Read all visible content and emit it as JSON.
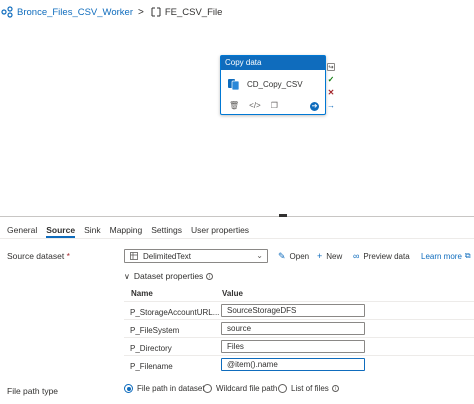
{
  "breadcrumb": {
    "pipeline": "Bronce_Files_CSV_Worker",
    "separator": ">",
    "current": "FE_CSV_File"
  },
  "activity": {
    "type": "Copy data",
    "name": "CD_Copy_CSV"
  },
  "tabs": [
    {
      "label": "General"
    },
    {
      "label": "Source"
    },
    {
      "label": "Sink"
    },
    {
      "label": "Mapping"
    },
    {
      "label": "Settings"
    },
    {
      "label": "User properties"
    }
  ],
  "source": {
    "label": "Source dataset",
    "required": "*",
    "dataset": "DelimitedText",
    "open": "Open",
    "new": "New",
    "preview": "Preview data",
    "learn_more": "Learn more"
  },
  "properties": {
    "heading": "Dataset properties",
    "col_name": "Name",
    "col_value": "Value",
    "rows": [
      {
        "name": "P_StorageAccountURL...",
        "value": "SourceStorageDFS"
      },
      {
        "name": "P_FileSystem",
        "value": "source"
      },
      {
        "name": "P_Directory",
        "value": "Files"
      },
      {
        "name": "P_Filename",
        "value": "@item().name"
      }
    ]
  },
  "file_path_type": {
    "label": "File path type",
    "options": [
      {
        "label": "File path in dataset",
        "selected": true
      },
      {
        "label": "Wildcard file path",
        "selected": false
      },
      {
        "label": "List of files",
        "selected": false
      }
    ]
  },
  "colors": {
    "accent": "#0f6cbd",
    "success": "#107c10",
    "error": "#a4262c"
  }
}
